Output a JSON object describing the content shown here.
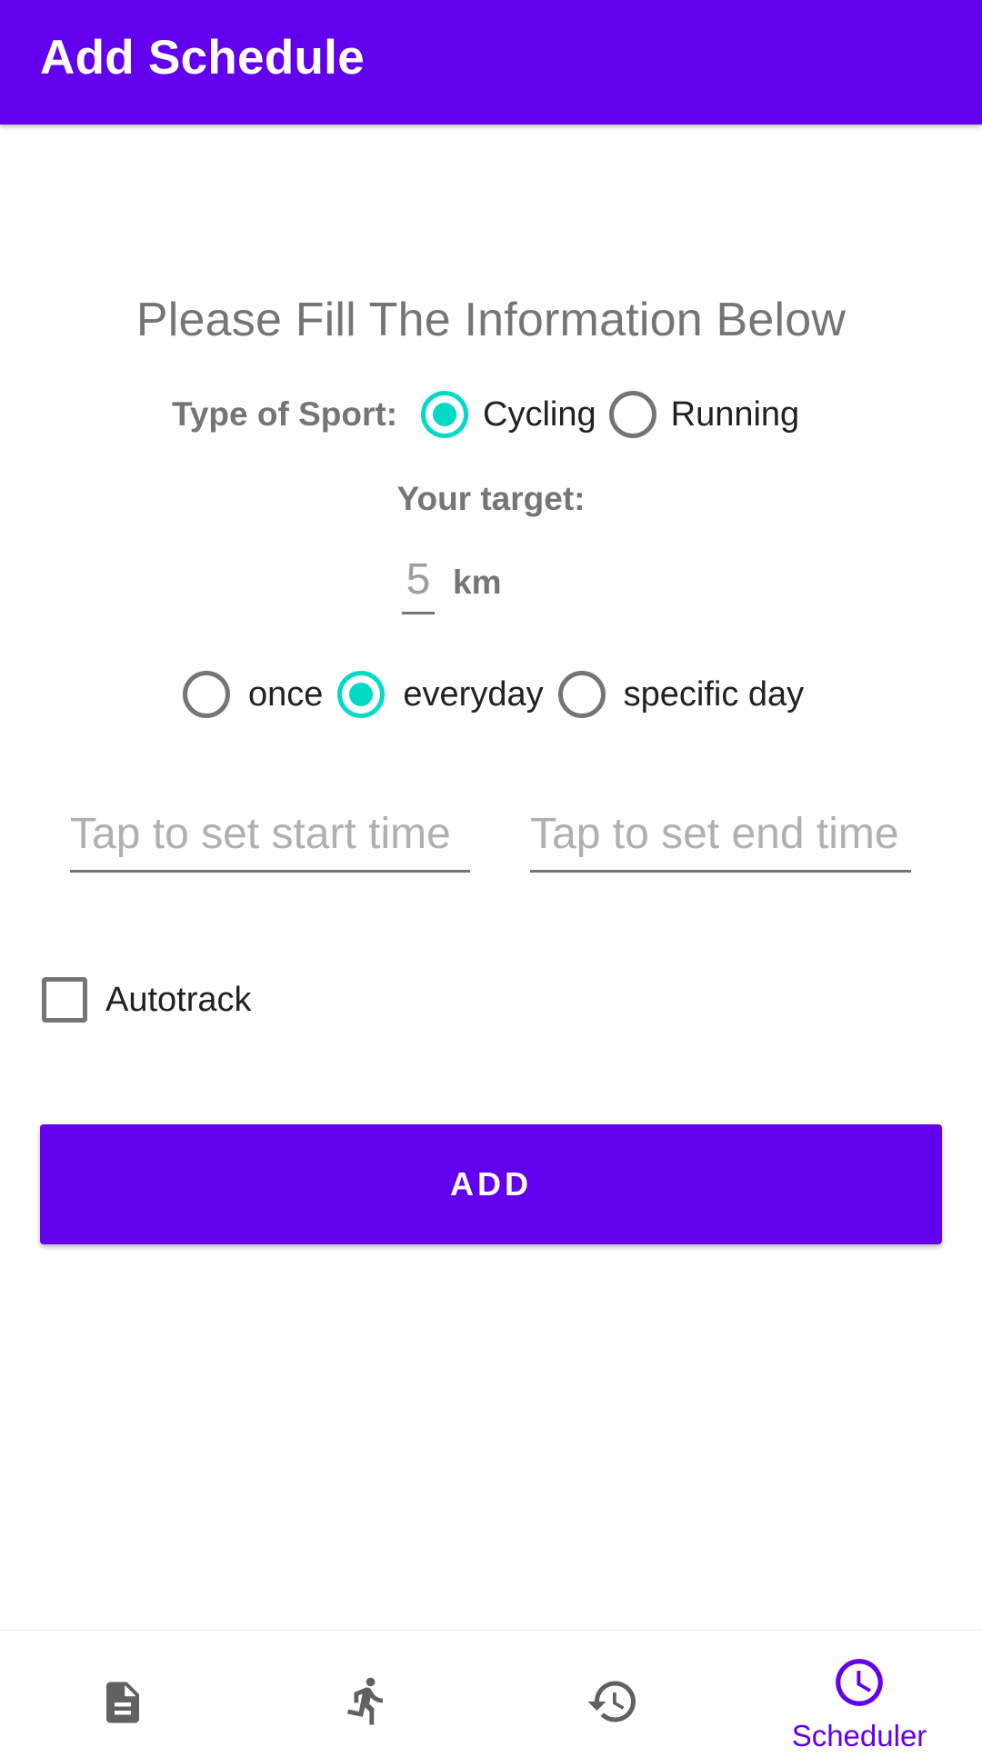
{
  "appbar": {
    "title": "Add Schedule"
  },
  "form": {
    "heading": "Please Fill The Information Below",
    "sport": {
      "label": "Type of Sport:",
      "options": [
        {
          "label": "Cycling",
          "checked": true
        },
        {
          "label": "Running",
          "checked": false
        }
      ]
    },
    "target": {
      "label": "Your target:",
      "value": "5",
      "unit": "km"
    },
    "frequency": {
      "options": [
        {
          "label": "once",
          "checked": false
        },
        {
          "label": "everyday",
          "checked": true
        },
        {
          "label": "specific day",
          "checked": false
        }
      ]
    },
    "start_time": {
      "placeholder": "Tap to set start time"
    },
    "end_time": {
      "placeholder": "Tap to set end time"
    },
    "autotrack": {
      "label": "Autotrack",
      "checked": false
    },
    "add_button": "ADD"
  },
  "bottom_nav": {
    "items": [
      {
        "icon": "document-icon",
        "label": "",
        "active": false
      },
      {
        "icon": "running-icon",
        "label": "",
        "active": false
      },
      {
        "icon": "history-icon",
        "label": "",
        "active": false
      },
      {
        "icon": "clock-icon",
        "label": "Scheduler",
        "active": true
      }
    ]
  },
  "colors": {
    "primary": "#6200ee",
    "accent": "#03dac5",
    "inactive_icon": "#616161",
    "hint_text": "#b0b0b0"
  }
}
